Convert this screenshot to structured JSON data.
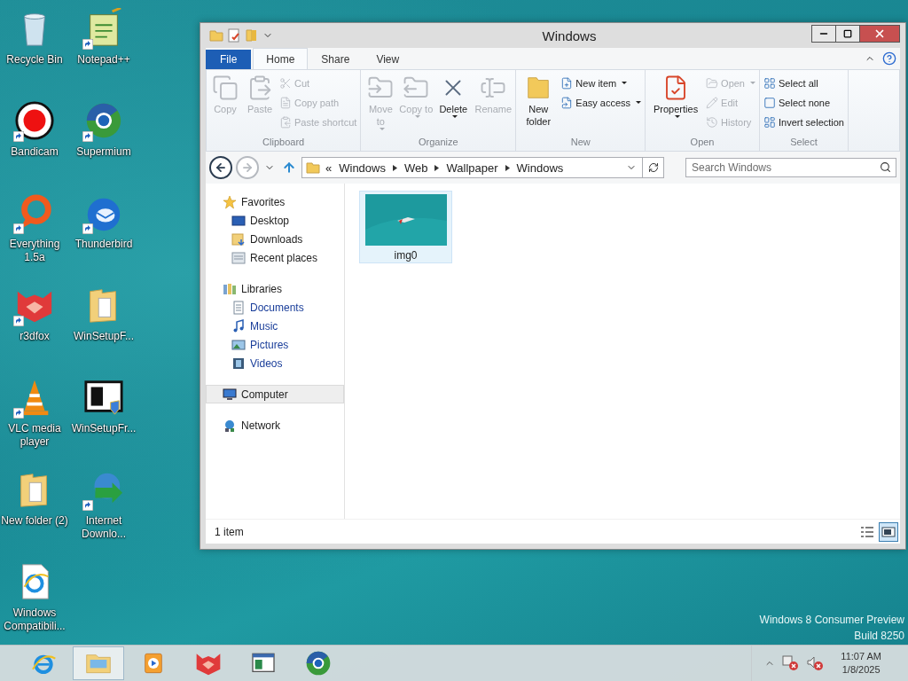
{
  "desktop_icons": [
    {
      "label": "Recycle Bin",
      "kind": "recycle",
      "shortcut": false
    },
    {
      "label": "Notepad++",
      "kind": "notepad",
      "shortcut": true
    },
    {
      "label": "Bandicam",
      "kind": "bandicam",
      "shortcut": true
    },
    {
      "label": "Supermium",
      "kind": "supermium",
      "shortcut": true
    },
    {
      "label": "Everything 1.5a",
      "kind": "everything",
      "shortcut": true
    },
    {
      "label": "Thunderbird",
      "kind": "thunderbird",
      "shortcut": true
    },
    {
      "label": "r3dfox",
      "kind": "r3dfox",
      "shortcut": true
    },
    {
      "label": "WinSetupF...",
      "kind": "folder",
      "shortcut": false
    },
    {
      "label": "VLC media player",
      "kind": "vlc",
      "shortcut": true
    },
    {
      "label": "WinSetupFr...",
      "kind": "setup",
      "shortcut": false
    },
    {
      "label": "New folder (2)",
      "kind": "folder",
      "shortcut": false
    },
    {
      "label": "Internet Downlo...",
      "kind": "idm",
      "shortcut": true
    },
    {
      "label": "Windows Compatibili...",
      "kind": "iedoc",
      "shortcut": false
    }
  ],
  "window": {
    "title": "Windows"
  },
  "ribbon_tabs": [
    {
      "label": "File",
      "kind": "file",
      "selected": false
    },
    {
      "label": "Home",
      "kind": "tab",
      "selected": true
    },
    {
      "label": "Share",
      "kind": "tab",
      "selected": false
    },
    {
      "label": "View",
      "kind": "tab",
      "selected": false
    }
  ],
  "ribbon_groups": [
    {
      "label": "Clipboard",
      "items": [
        {
          "label": "Copy",
          "kind": "large",
          "disabled": true,
          "dropdown": false
        },
        {
          "label": "Paste",
          "kind": "large",
          "disabled": true,
          "dropdown": false
        },
        {
          "label": "Cut",
          "kind": "small",
          "disabled": true,
          "dropdown": false
        },
        {
          "label": "Copy path",
          "kind": "small",
          "disabled": true,
          "dropdown": false
        },
        {
          "label": "Paste shortcut",
          "kind": "small",
          "disabled": true,
          "dropdown": false
        }
      ]
    },
    {
      "label": "Organize",
      "items": [
        {
          "label": "Move to",
          "kind": "large",
          "disabled": true,
          "dropdown": true
        },
        {
          "label": "Copy to",
          "kind": "large",
          "disabled": true,
          "dropdown": true
        },
        {
          "label": "Delete",
          "kind": "large",
          "disabled": false,
          "dropdown": true
        },
        {
          "label": "Rename",
          "kind": "large",
          "disabled": true,
          "dropdown": false
        }
      ]
    },
    {
      "label": "New",
      "items": [
        {
          "label": "New folder",
          "kind": "large",
          "disabled": false,
          "dropdown": false
        },
        {
          "label": "New item",
          "kind": "small",
          "disabled": false,
          "dropdown": true
        },
        {
          "label": "Easy access",
          "kind": "small",
          "disabled": false,
          "dropdown": true
        }
      ]
    },
    {
      "label": "Open",
      "items": [
        {
          "label": "Properties",
          "kind": "large",
          "disabled": false,
          "dropdown": true
        },
        {
          "label": "Open",
          "kind": "small",
          "disabled": true,
          "dropdown": true
        },
        {
          "label": "Edit",
          "kind": "small",
          "disabled": true,
          "dropdown": false
        },
        {
          "label": "History",
          "kind": "small",
          "disabled": true,
          "dropdown": false
        }
      ]
    },
    {
      "label": "Select",
      "items": [
        {
          "label": "Select all",
          "kind": "small",
          "disabled": false,
          "dropdown": false
        },
        {
          "label": "Select none",
          "kind": "small",
          "disabled": false,
          "dropdown": false
        },
        {
          "label": "Invert selection",
          "kind": "small",
          "disabled": false,
          "dropdown": false
        }
      ]
    }
  ],
  "address": {
    "overflow": "«",
    "segments": [
      "Windows",
      "Web",
      "Wallpaper",
      "Windows"
    ]
  },
  "search": {
    "placeholder": "Search Windows"
  },
  "navigation": [
    {
      "label": "Favorites",
      "kind": "favorites",
      "selected": false,
      "children": [
        {
          "label": "Desktop",
          "kind": "desktop",
          "selected": false
        },
        {
          "label": "Downloads",
          "kind": "downloads",
          "selected": false
        },
        {
          "label": "Recent places",
          "kind": "recent",
          "selected": false
        }
      ]
    },
    {
      "label": "Libraries",
      "kind": "libraries",
      "selected": false,
      "children": [
        {
          "label": "Documents",
          "kind": "documents",
          "selected": false
        },
        {
          "label": "Music",
          "kind": "music",
          "selected": false
        },
        {
          "label": "Pictures",
          "kind": "pictures",
          "selected": false
        },
        {
          "label": "Videos",
          "kind": "videos",
          "selected": false
        }
      ]
    },
    {
      "label": "Computer",
      "kind": "computer",
      "selected": true
    },
    {
      "label": "Network",
      "kind": "network",
      "selected": false
    }
  ],
  "files": [
    {
      "name": "img0",
      "selected": true
    }
  ],
  "status_bar": {
    "text": "1 item",
    "views": [
      {
        "kind": "details",
        "selected": false
      },
      {
        "kind": "large-icons",
        "selected": true
      }
    ]
  },
  "os_build": [
    "Windows 8 Consumer Preview",
    "Build 8250"
  ],
  "taskbar": {
    "apps": [
      {
        "kind": "ie",
        "active": false
      },
      {
        "kind": "explorer",
        "active": true
      },
      {
        "kind": "player",
        "active": false
      },
      {
        "kind": "r3dfox",
        "active": false
      },
      {
        "kind": "window",
        "active": false
      },
      {
        "kind": "supermium",
        "active": false
      }
    ],
    "clock": {
      "time": "11:07 AM",
      "date": "1/8/2025"
    }
  }
}
